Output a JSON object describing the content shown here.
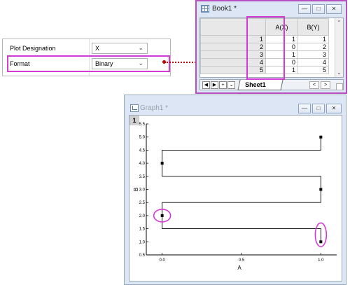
{
  "properties": {
    "rows": [
      {
        "label": "Plot Designation",
        "value": "X"
      },
      {
        "label": "Format",
        "value": "Binary"
      }
    ]
  },
  "workbook": {
    "title": "Book1 *",
    "columns": [
      "A(X)",
      "B(Y)"
    ],
    "rows": [
      {
        "n": "1",
        "a": "1",
        "b": "1"
      },
      {
        "n": "2",
        "a": "0",
        "b": "2"
      },
      {
        "n": "3",
        "a": "1",
        "b": "3"
      },
      {
        "n": "4",
        "a": "0",
        "b": "4"
      },
      {
        "n": "5",
        "a": "1",
        "b": "5"
      }
    ],
    "sheet_tab": "Sheet1"
  },
  "graph": {
    "title": "Graph1 *",
    "layer": "1"
  },
  "chart_data": {
    "type": "line",
    "x": [
      1,
      0,
      1,
      0,
      1
    ],
    "y": [
      1,
      2,
      3,
      4,
      5
    ],
    "step": "horizontal-then-vertical",
    "xlabel": "A",
    "ylabel": "B",
    "xlim": [
      -0.1,
      1.1
    ],
    "ylim": [
      0.5,
      5.5
    ],
    "xticks": [
      "0.0",
      "0.5",
      "1.0"
    ],
    "yticks": [
      "0.5",
      "1.0",
      "1.5",
      "2.0",
      "2.5",
      "3.0",
      "3.5",
      "4.0",
      "4.5",
      "5.0",
      "5.5"
    ],
    "highlighted_points": [
      [
        0,
        2
      ],
      [
        1,
        1
      ]
    ],
    "grid": false,
    "colors": {
      "line": "#000000",
      "highlight": "#d63ad6"
    }
  }
}
